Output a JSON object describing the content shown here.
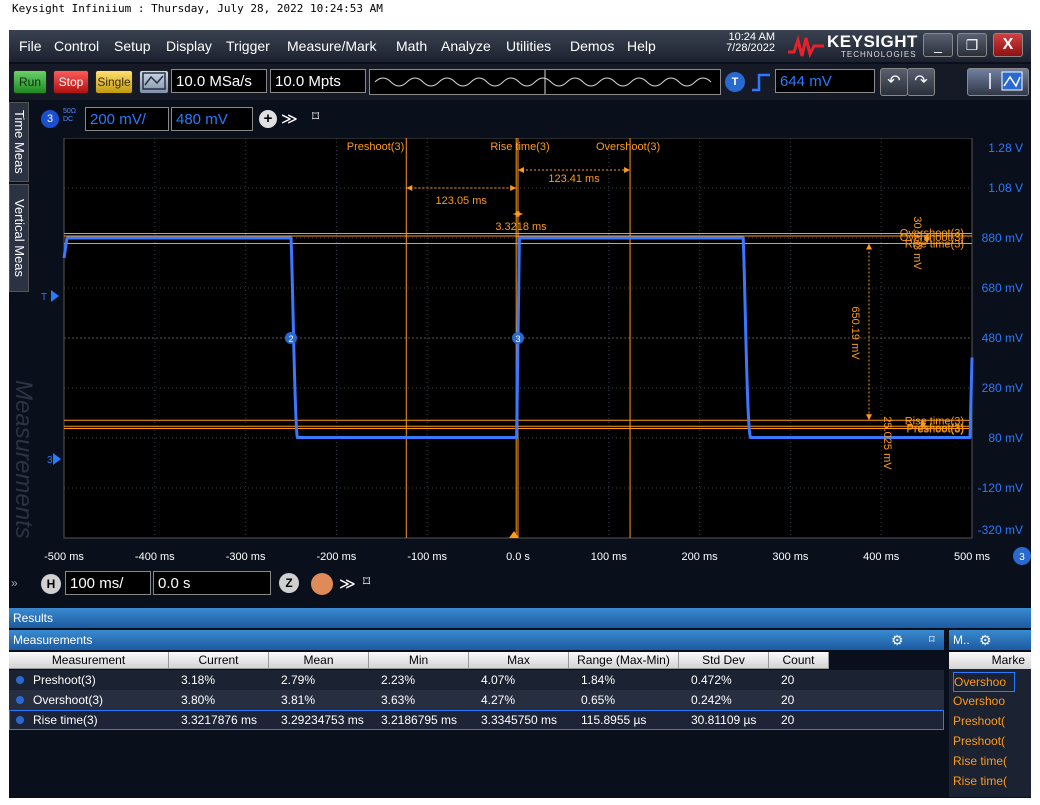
{
  "caption": "Keysight Infiniium : Thursday, July 28, 2022 10:24:53 AM",
  "menu": [
    "File",
    "Control",
    "Setup",
    "Display",
    "Trigger",
    "Measure/Mark",
    "Math",
    "Analyze",
    "Utilities",
    "Demos",
    "Help"
  ],
  "clock": {
    "time": "10:24 AM",
    "date": "7/28/2022"
  },
  "brand": {
    "name": "KEYSIGHT",
    "sub": "TECHNOLOGIES"
  },
  "window_buttons": {
    "minimize": "_",
    "restore": "❐",
    "close": "X"
  },
  "toolbar": {
    "run": "Run",
    "stop": "Stop",
    "single": "Single",
    "sample_rate": "10.0 MSa/s",
    "memory_depth": "10.0 Mpts",
    "trigger_badge": "T",
    "trigger_level": "644 mV",
    "undo": "↶",
    "redo": "↷"
  },
  "side_tabs": {
    "time": "Time Meas",
    "vertical": "Vertical Meas",
    "watermark": "Measurements"
  },
  "channel": {
    "badge": "3",
    "coupling": "50Ω DC",
    "scale": "200 mV/",
    "offset": "480 mV",
    "plus": "+",
    "more": "≫",
    "pin": "⌑"
  },
  "scope": {
    "y_labels": [
      "1.28 V",
      "1.08 V",
      "880 mV",
      "680 mV",
      "480 mV",
      "280 mV",
      "80 mV",
      "-120 mV",
      "-320 mV"
    ],
    "x_labels": [
      "-500 ms",
      "-400 ms",
      "-300 ms",
      "-200 ms",
      "-100 ms",
      "0.0 s",
      "100 ms",
      "200 ms",
      "300 ms",
      "400 ms",
      "500 ms"
    ],
    "marker_labels": {
      "preshoot_top": "Preshoot(3)",
      "overlap_top": "Rise time(3)",
      "overshoot_top": "Overshoot(3)",
      "overshoot_right_1": "Overshoot(3)",
      "overshoot_right_2": "Overshoot(3)",
      "risetime_right_top": "Rise time(3)",
      "risetime_right_bottom": "Rise time(3)",
      "preshoot_right_1": "Preshoot(3)",
      "preshoot_right_2": "Preshoot(3)"
    },
    "dimensions": {
      "d_left": "123.05 ms",
      "d_right": "123.41 ms",
      "d_rise": "3.3218 ms",
      "d_amp": "650.19 mV",
      "d_over": "30.933 mV",
      "d_pre": "25.025 mV"
    },
    "ch_marker_2": "2",
    "ch_marker_3": "3",
    "trig_mark": "T",
    "ground_mark": "3"
  },
  "horizontal": {
    "badge": "H",
    "scale": "100 ms/",
    "position": "0.0 s",
    "zoom": "Z",
    "more": "≫",
    "pin": "⌑",
    "expand": "»"
  },
  "results": {
    "title": "Results",
    "panel_title": "Measurements",
    "markers_title": "M..",
    "columns": [
      "Measurement",
      "Current",
      "Mean",
      "Min",
      "Max",
      "Range (Max-Min)",
      "Std Dev",
      "Count"
    ],
    "rows": [
      {
        "name": "Preshoot(3)",
        "current": "3.18%",
        "mean": "2.79%",
        "min": "2.23%",
        "max": "4.07%",
        "range": "1.84%",
        "std": "0.472%",
        "count": "20"
      },
      {
        "name": "Overshoot(3)",
        "current": "3.80%",
        "mean": "3.81%",
        "min": "3.63%",
        "max": "4.27%",
        "range": "0.65%",
        "std": "0.242%",
        "count": "20"
      },
      {
        "name": "Rise time(3)",
        "current": "3.3217876 ms",
        "mean": "3.29234753 ms",
        "min": "3.2186795 ms",
        "max": "3.3345750 ms",
        "range": "115.8955 µs",
        "std": "30.81109 µs",
        "count": "20"
      }
    ],
    "markers_header": "Marke",
    "markers": [
      "Overshoo",
      "Overshoo",
      "Preshoot(",
      "Preshoot(",
      "Rise time(",
      "Rise time("
    ]
  },
  "colors": {
    "trace": "#3a78ff",
    "marker": "#ff9a1a",
    "grid": "#3a3f4a",
    "accent": "#2a7aff"
  }
}
